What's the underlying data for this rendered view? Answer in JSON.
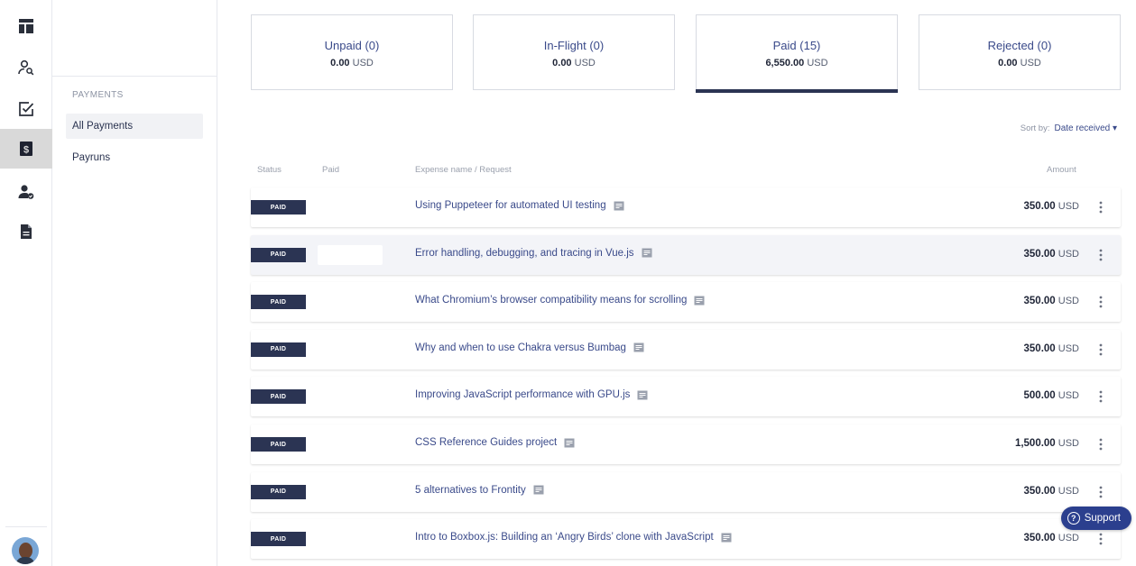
{
  "colors": {
    "accent": "#2b3453",
    "link": "#3a4a8a",
    "support_bg": "#2b3f8e"
  },
  "rail": {
    "items": [
      {
        "icon": "dashboard-icon"
      },
      {
        "icon": "user-search-icon"
      },
      {
        "icon": "checkbox-icon"
      },
      {
        "icon": "dollar-icon",
        "active": true
      },
      {
        "icon": "user-check-icon"
      },
      {
        "icon": "document-icon"
      }
    ]
  },
  "subnav": {
    "section": "PAYMENTS",
    "items": [
      {
        "label": "All Payments",
        "active": true
      },
      {
        "label": "Payruns"
      }
    ]
  },
  "cards": [
    {
      "title": "Unpaid (0)",
      "amount": "0.00",
      "currency": "USD"
    },
    {
      "title": "In-Flight (0)",
      "amount": "0.00",
      "currency": "USD"
    },
    {
      "title": "Paid (15)",
      "amount": "6,550.00",
      "currency": "USD",
      "selected": true
    },
    {
      "title": "Rejected (0)",
      "amount": "0.00",
      "currency": "USD"
    }
  ],
  "sort": {
    "label": "Sort by:",
    "value": "Date received ▾"
  },
  "table": {
    "headers": {
      "status": "Status",
      "paid": "Paid",
      "expense": "Expense name / Request",
      "amount": "Amount"
    },
    "rows": [
      {
        "status": "PAID",
        "title": "Using Puppeteer for automated UI testing",
        "amount": "350.00",
        "currency": "USD"
      },
      {
        "status": "PAID",
        "title": "Error handling, debugging, and tracing in Vue.js",
        "amount": "350.00",
        "currency": "USD"
      },
      {
        "status": "PAID",
        "title": "What Chromium’s browser compatibility means for scrolling",
        "amount": "350.00",
        "currency": "USD"
      },
      {
        "status": "PAID",
        "title": "Why and when to use Chakra versus Bumbag",
        "amount": "350.00",
        "currency": "USD"
      },
      {
        "status": "PAID",
        "title": "Improving JavaScript performance with GPU.js",
        "amount": "500.00",
        "currency": "USD"
      },
      {
        "status": "PAID",
        "title": "CSS Reference Guides project",
        "amount": "1,500.00",
        "currency": "USD"
      },
      {
        "status": "PAID",
        "title": "5 alternatives to Frontity",
        "amount": "350.00",
        "currency": "USD"
      },
      {
        "status": "PAID",
        "title": "Intro to Boxbox.js: Building an ‘Angry Birds’ clone with JavaScript",
        "amount": "350.00",
        "currency": "USD"
      }
    ]
  },
  "support": {
    "label": "Support",
    "icon": "question-icon"
  }
}
